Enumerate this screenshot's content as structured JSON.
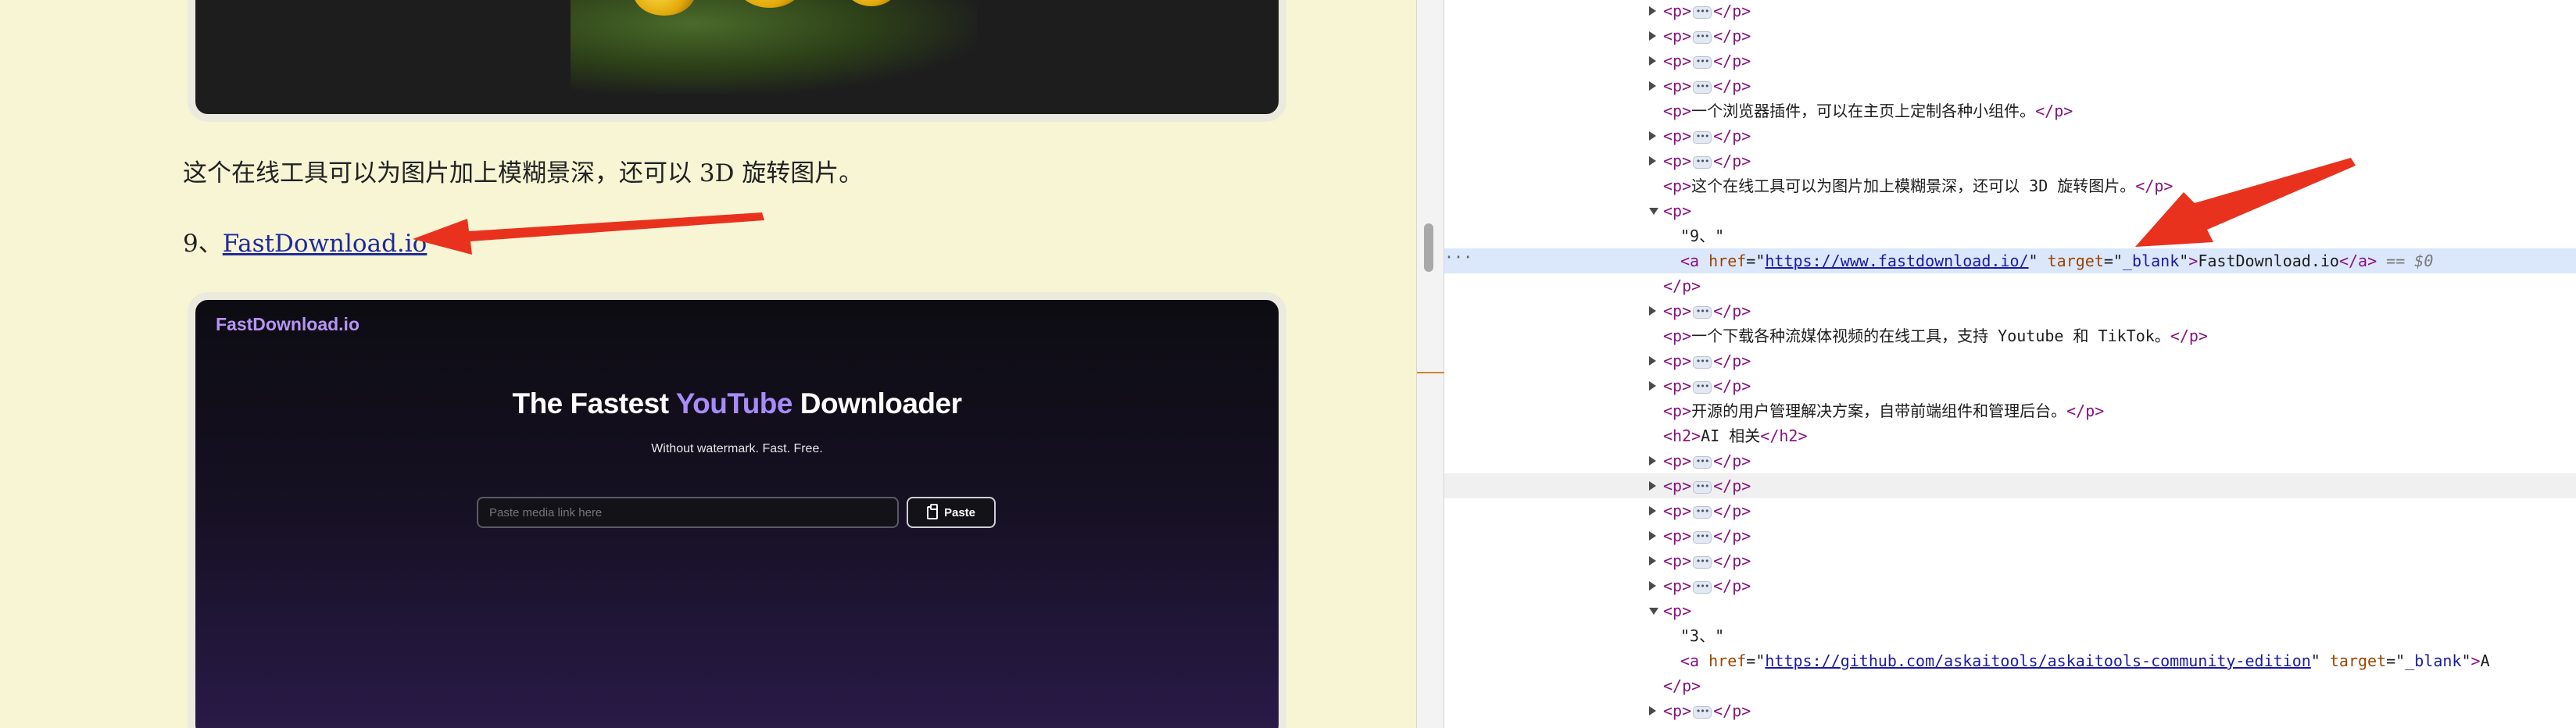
{
  "page": {
    "description_text": "这个在线工具可以为图片加上模糊景深，还可以 3D 旋转图片。",
    "item_prefix": "9、",
    "item_link_text": "FastDownload.io"
  },
  "embedded_site": {
    "logo": "FastDownload.io",
    "headline_before": "The Fastest ",
    "headline_highlight": "YouTube",
    "headline_after": " Downloader",
    "subtitle": "Without watermark. Fast. Free.",
    "input_placeholder": "Paste media link here",
    "paste_button": "Paste"
  },
  "colors": {
    "page_bg": "#f7f5d4",
    "arrow": "#e8321e",
    "brand_purple": "#a78bfa",
    "selected_row": "#dbe7fb"
  },
  "devtools": {
    "gutter_dots": "···",
    "lines": [
      {
        "indent": 1,
        "toggle": "collapsed",
        "kind": "collapsed_p"
      },
      {
        "indent": 1,
        "toggle": "collapsed",
        "kind": "collapsed_p"
      },
      {
        "indent": 1,
        "toggle": "collapsed",
        "kind": "collapsed_p"
      },
      {
        "indent": 1,
        "toggle": "collapsed",
        "kind": "collapsed_p"
      },
      {
        "indent": 1,
        "toggle": "none",
        "kind": "text_element",
        "tag": "p",
        "text": "一个浏览器插件，可以在主页上定制各种小组件。"
      },
      {
        "indent": 1,
        "toggle": "collapsed",
        "kind": "collapsed_p"
      },
      {
        "indent": 1,
        "toggle": "collapsed",
        "kind": "collapsed_p"
      },
      {
        "indent": 1,
        "toggle": "none",
        "kind": "text_element",
        "tag": "p",
        "text": "这个在线工具可以为图片加上模糊景深，还可以 3D 旋转图片。"
      },
      {
        "indent": 1,
        "toggle": "expanded",
        "kind": "open_tag",
        "tag": "p"
      },
      {
        "indent": 2,
        "toggle": "none",
        "kind": "text_node",
        "text": "\"9、\""
      },
      {
        "indent": 2,
        "toggle": "none",
        "kind": "anchor",
        "href": "https://www.fastdownload.io/",
        "target": "_blank",
        "text": "FastDownload.io",
        "selected": true,
        "suffix": "== $0"
      },
      {
        "indent": 1,
        "toggle": "none",
        "kind": "close_tag",
        "tag": "p"
      },
      {
        "indent": 1,
        "toggle": "collapsed",
        "kind": "collapsed_p"
      },
      {
        "indent": 1,
        "toggle": "none",
        "kind": "text_element",
        "tag": "p",
        "text": "一个下载各种流媒体视频的在线工具，支持 Youtube 和 TikTok。"
      },
      {
        "indent": 1,
        "toggle": "collapsed",
        "kind": "collapsed_p"
      },
      {
        "indent": 1,
        "toggle": "collapsed",
        "kind": "collapsed_p"
      },
      {
        "indent": 1,
        "toggle": "none",
        "kind": "text_element",
        "tag": "p",
        "text": "开源的用户管理解决方案，自带前端组件和管理后台。"
      },
      {
        "indent": 1,
        "toggle": "none",
        "kind": "text_element",
        "tag": "h2",
        "text": "AI 相关"
      },
      {
        "indent": 1,
        "toggle": "collapsed",
        "kind": "collapsed_p"
      },
      {
        "indent": 1,
        "toggle": "collapsed",
        "kind": "collapsed_p",
        "hovered": true
      },
      {
        "indent": 1,
        "toggle": "collapsed",
        "kind": "collapsed_p"
      },
      {
        "indent": 1,
        "toggle": "collapsed",
        "kind": "collapsed_p"
      },
      {
        "indent": 1,
        "toggle": "collapsed",
        "kind": "collapsed_p"
      },
      {
        "indent": 1,
        "toggle": "collapsed",
        "kind": "collapsed_p"
      },
      {
        "indent": 1,
        "toggle": "expanded",
        "kind": "open_tag",
        "tag": "p"
      },
      {
        "indent": 2,
        "toggle": "none",
        "kind": "text_node",
        "text": "\"3、\""
      },
      {
        "indent": 2,
        "toggle": "none",
        "kind": "anchor",
        "href": "https://github.com/askaitools/askaitools-community-edition",
        "target": "_blank",
        "text": "A",
        "selected": false,
        "suffix": ""
      },
      {
        "indent": 1,
        "toggle": "none",
        "kind": "close_tag",
        "tag": "p"
      },
      {
        "indent": 1,
        "toggle": "collapsed",
        "kind": "collapsed_p"
      }
    ]
  }
}
